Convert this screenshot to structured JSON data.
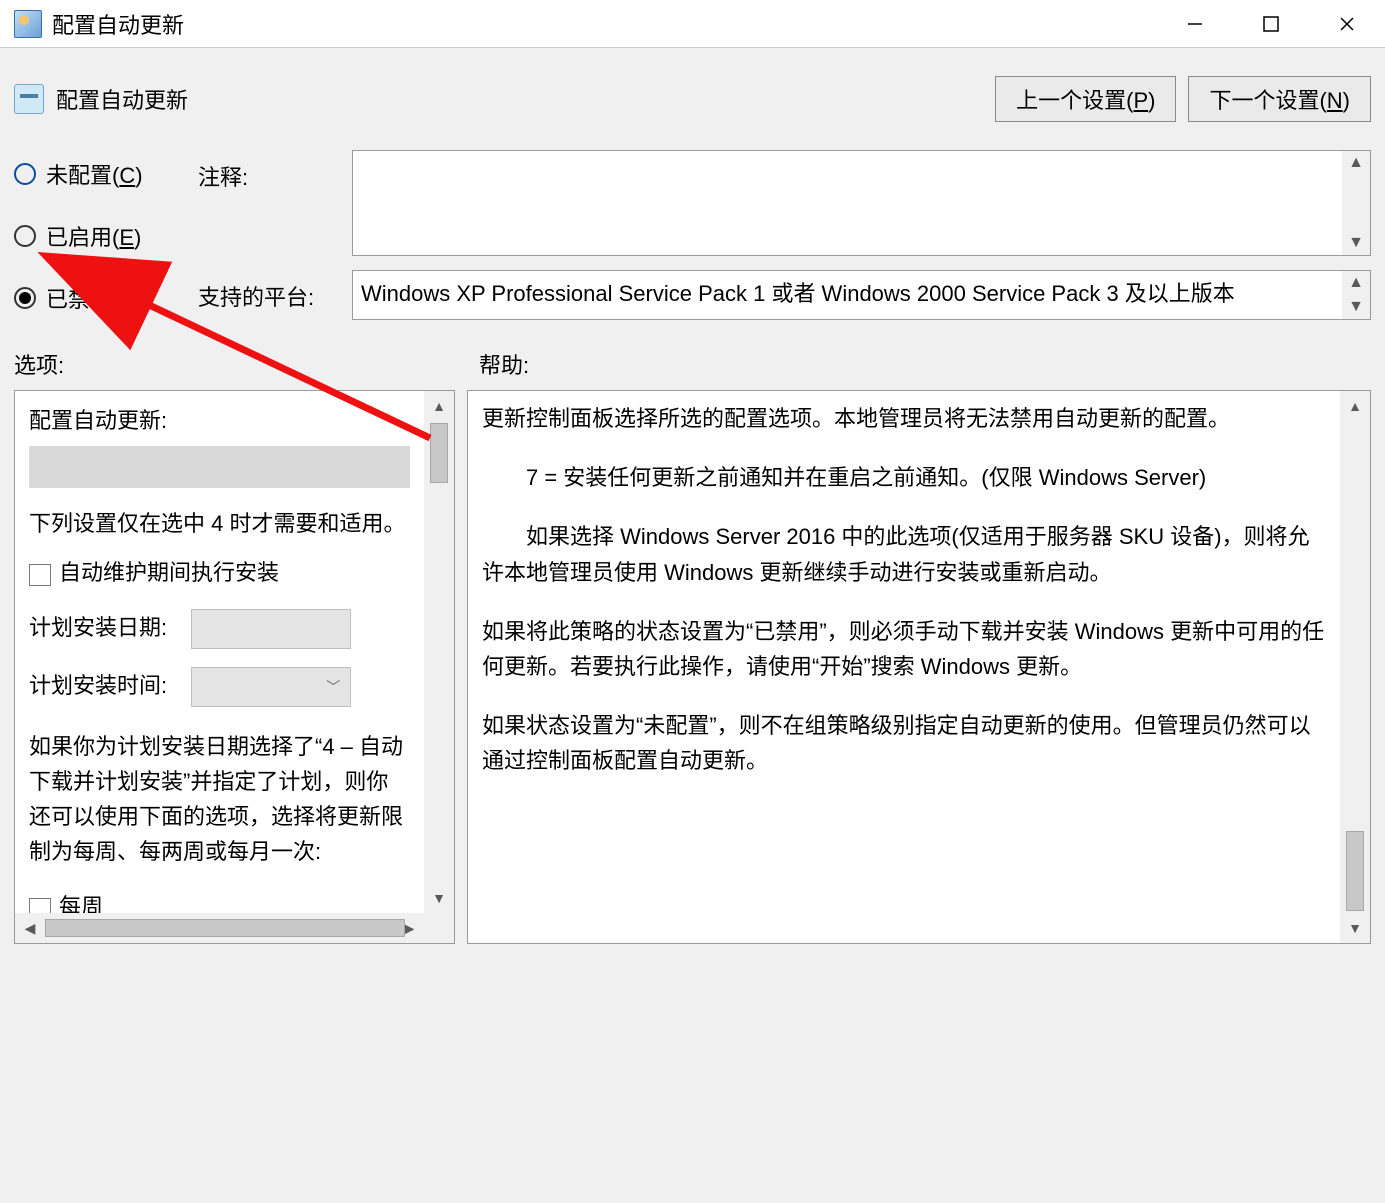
{
  "window": {
    "title": "配置自动更新"
  },
  "header": {
    "policy_title": "配置自动更新",
    "prev_setting": "上一个设置(",
    "prev_key": "P",
    "prev_close": ")",
    "next_setting": "下一个设置(",
    "next_key": "N",
    "next_close": ")"
  },
  "radios": {
    "not_configured_pre": "未配置(",
    "not_configured_key": "C",
    "not_configured_post": ")",
    "enabled_pre": "已启用(",
    "enabled_key": "E",
    "enabled_post": ")",
    "disabled_pre": "已禁用(",
    "disabled_key": "D",
    "disabled_post": ")",
    "selected": "disabled"
  },
  "labels": {
    "comment": "注释:",
    "supported": "支持的平台:",
    "options": "选项:",
    "help": "帮助:"
  },
  "supported_platform": "Windows XP Professional Service Pack 1 或者 Windows 2000 Service Pack 3 及以上版本",
  "options": {
    "configure_label": "配置自动更新:",
    "note_line": "下列设置仅在选中 4 时才需要和适用。",
    "maintenance_checkbox": "自动维护期间执行安装",
    "install_day_label": "计划安装日期:",
    "install_time_label": "计划安装时间:",
    "long_note": "如果你为计划安装日期选择了“4 – 自动下载并计划安装”并指定了计划，则你还可以使用下面的选项，选择将更新限制为每周、每两周或每月一次:",
    "weekly_checkbox": "每周"
  },
  "help": {
    "p1": "更新控制面板选择所选的配置选项。本地管理员将无法禁用自动更新的配置。",
    "p2": "7 = 安装任何更新之前通知并在重启之前通知。(仅限 Windows Server)",
    "p3": "如果选择 Windows Server 2016 中的此选项(仅适用于服务器 SKU 设备)，则将允许本地管理员使用 Windows 更新继续手动进行安装或重新启动。",
    "p4": "如果将此策略的状态设置为“已禁用”，则必须手动下载并安装 Windows 更新中可用的任何更新。若要执行此操作，请使用“开始”搜索 Windows 更新。",
    "p5": "如果状态设置为“未配置”，则不在组策略级别指定自动更新的使用。但管理员仍然可以通过控制面板配置自动更新。"
  }
}
